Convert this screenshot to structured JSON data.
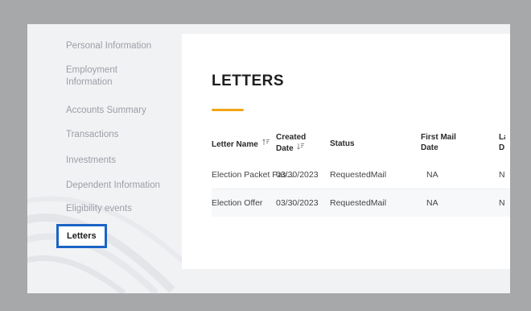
{
  "sidebar": {
    "items": [
      {
        "label": "Personal Information"
      },
      {
        "label": "Employment Information"
      },
      {
        "label": "Accounts Summary"
      },
      {
        "label": "Transactions"
      },
      {
        "label": "Investments"
      },
      {
        "label": "Dependent Information"
      },
      {
        "label": "Eligibility events"
      },
      {
        "label": "Letters"
      }
    ],
    "active_index": 7
  },
  "main": {
    "title": "LETTERS",
    "accent_color": "#f2a514",
    "table": {
      "columns": [
        {
          "label": "Letter Name",
          "sort_icon": "sort-ascending-icon"
        },
        {
          "label": "Created Date",
          "sort_icon": "sort-descending-icon"
        },
        {
          "label": "Status"
        },
        {
          "label": "First Mail Date"
        },
        {
          "label": "La D"
        }
      ],
      "rows": [
        {
          "letter_name": "Election Packet Pas...",
          "created_date": "03/30/2023",
          "status": "RequestedMail",
          "first_mail_date": "NA",
          "last": "N"
        },
        {
          "letter_name": "Election Offer",
          "created_date": "03/30/2023",
          "status": "RequestedMail",
          "first_mail_date": "NA",
          "last": "N"
        }
      ]
    }
  },
  "colors": {
    "highlight_border": "#1a64c6",
    "background": "#a7a8aa"
  }
}
